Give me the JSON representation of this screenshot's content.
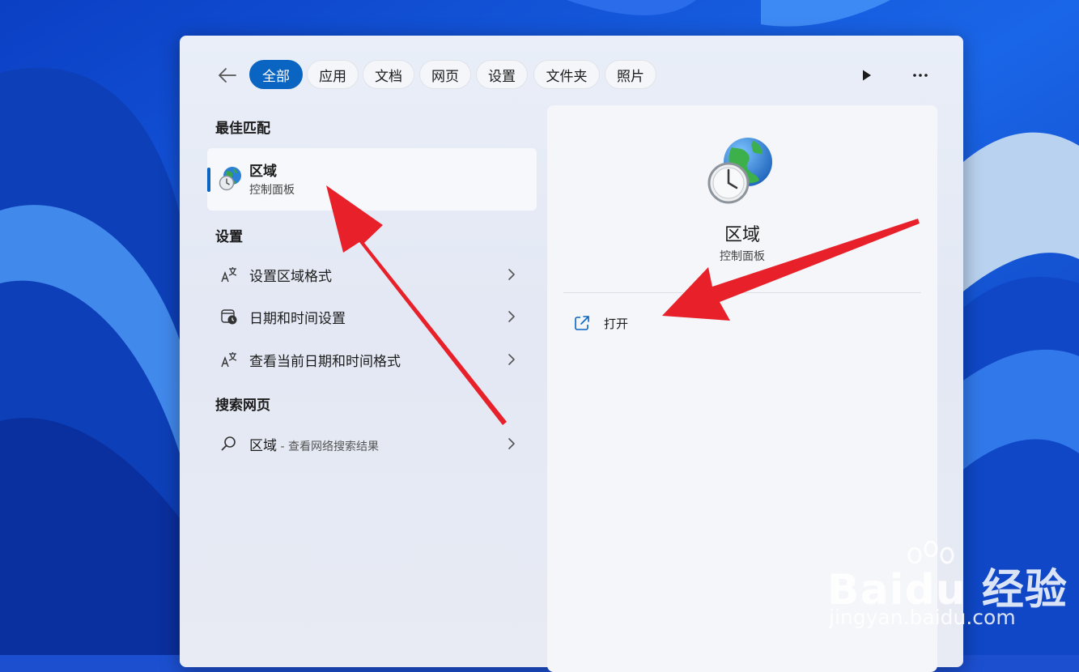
{
  "filter_tabs": [
    {
      "label": "全部",
      "active": true
    },
    {
      "label": "应用",
      "active": false
    },
    {
      "label": "文档",
      "active": false
    },
    {
      "label": "网页",
      "active": false
    },
    {
      "label": "设置",
      "active": false
    },
    {
      "label": "文件夹",
      "active": false
    },
    {
      "label": "照片",
      "active": false
    }
  ],
  "toolbar": {
    "back_icon": "arrow-left-icon",
    "play_icon": "play-icon",
    "more_icon": "more-icon"
  },
  "best_match": {
    "heading": "最佳匹配",
    "title": "区域",
    "subtitle": "控制面板",
    "icon": "globe-clock-icon"
  },
  "settings_section": {
    "heading": "设置",
    "items": [
      {
        "label": "设置区域格式",
        "icon": "region-format-icon"
      },
      {
        "label": "日期和时间设置",
        "icon": "calendar-clock-icon"
      },
      {
        "label": "查看当前日期和时间格式",
        "icon": "region-format-icon"
      }
    ]
  },
  "web_section": {
    "heading": "搜索网页",
    "query": "区域",
    "suffix": " - 查看网络搜索结果",
    "icon": "search-icon"
  },
  "detail": {
    "title": "区域",
    "subtitle": "控制面板",
    "open_label": "打开",
    "open_icon": "open-external-icon"
  },
  "watermark": {
    "brand": "Baidu 经验",
    "url": "jingyan.baidu.com"
  },
  "colors": {
    "accent": "#0a64c2",
    "arrow": "#e8202a"
  }
}
